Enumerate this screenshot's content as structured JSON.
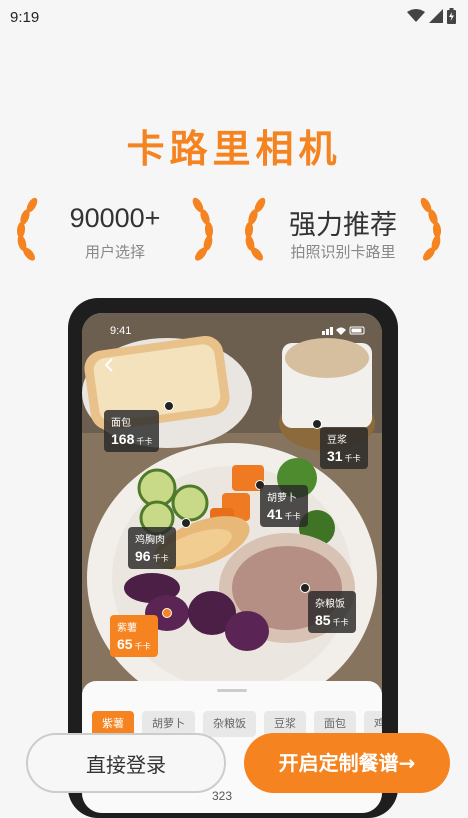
{
  "status_bar": {
    "time": "9:19"
  },
  "title": "卡路里相机",
  "stats": [
    {
      "value": "90000+",
      "label": "用户选择"
    },
    {
      "value": "强力推荐",
      "label": "拍照识别卡路里"
    }
  ],
  "phone": {
    "time": "9:41",
    "tags": [
      {
        "name": "面包",
        "calories": "168",
        "unit": "千卡"
      },
      {
        "name": "豆浆",
        "calories": "31",
        "unit": "千卡"
      },
      {
        "name": "胡萝卜",
        "calories": "41",
        "unit": "千卡"
      },
      {
        "name": "鸡胸肉",
        "calories": "96",
        "unit": "千卡"
      },
      {
        "name": "杂粮饭",
        "calories": "85",
        "unit": "千卡"
      },
      {
        "name": "紫薯",
        "calories": "65",
        "unit": "千卡"
      }
    ],
    "chips": [
      "紫薯",
      "胡萝卜",
      "杂粮饭",
      "豆浆",
      "面包",
      "鸡"
    ],
    "partial_number": "323"
  },
  "buttons": {
    "login": "直接登录",
    "start": "开启定制餐谱→"
  },
  "colors": {
    "accent": "#f5831f"
  }
}
